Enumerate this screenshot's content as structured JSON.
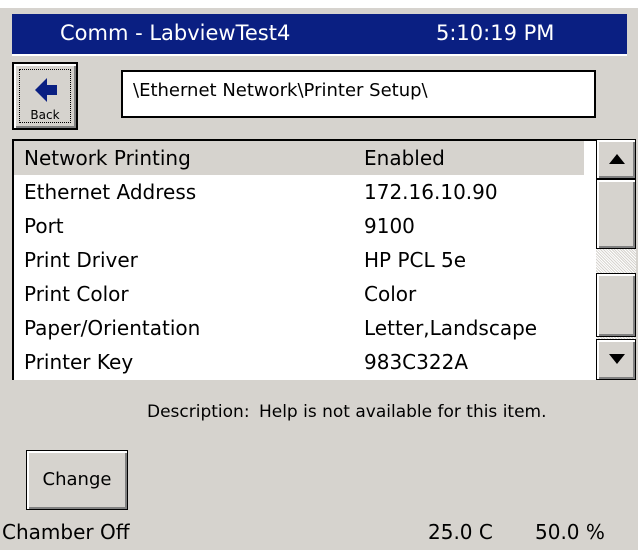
{
  "title_bar": {
    "title": "Comm - LabviewTest4",
    "time": "5:10:19 PM"
  },
  "toolbar": {
    "back_label": "Back",
    "path": "\\Ethernet Network\\Printer Setup\\"
  },
  "settings": [
    {
      "name": "Network Printing",
      "value": "Enabled",
      "selected": true
    },
    {
      "name": "Ethernet Address",
      "value": "172.16.10.90"
    },
    {
      "name": "Port",
      "value": "9100"
    },
    {
      "name": "Print Driver",
      "value": "HP PCL 5e"
    },
    {
      "name": "Print Color",
      "value": "Color"
    },
    {
      "name": "Paper/Orientation",
      "value": "Letter,Landscape"
    },
    {
      "name": "Printer Key",
      "value": "983C322A"
    }
  ],
  "description": {
    "label": "Description:",
    "text": "Help is not available for this item."
  },
  "change_label": "Change",
  "status": {
    "chamber": "Chamber Off",
    "temperature": "25.0 C",
    "humidity": "50.0 %"
  },
  "colors": {
    "titlebar": "#0a1f82",
    "background": "#d6d3ce",
    "selected_row": "#d6d3ce"
  },
  "icons": {
    "back": "left-arrow-icon",
    "scroll_up": "triangle-up-icon",
    "scroll_down": "triangle-down-icon"
  }
}
